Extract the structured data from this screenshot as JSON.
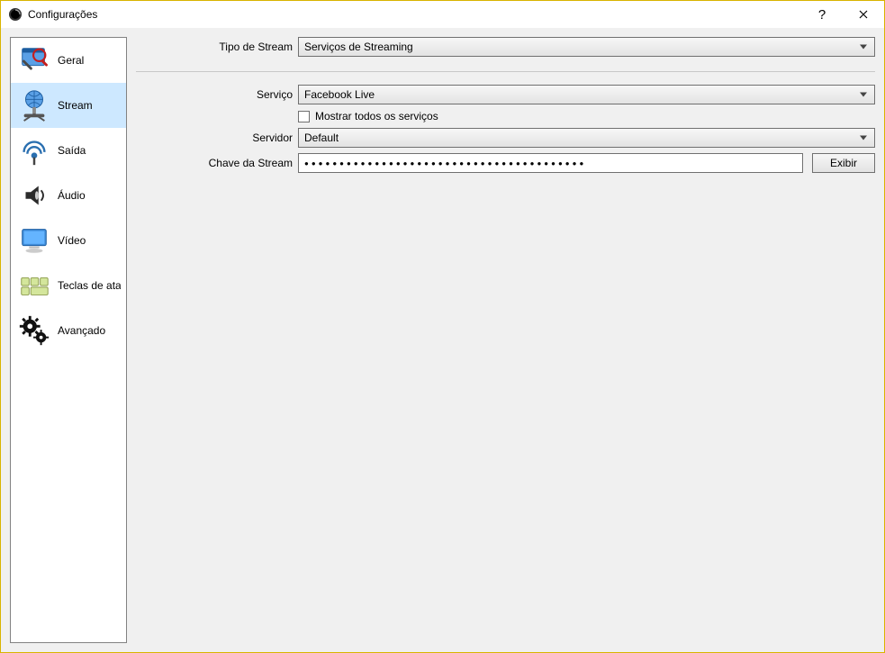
{
  "titlebar": {
    "title": "Configurações"
  },
  "sidebar": {
    "items": [
      {
        "label": "Geral"
      },
      {
        "label": "Stream"
      },
      {
        "label": "Saída"
      },
      {
        "label": "Áudio"
      },
      {
        "label": "Vídeo"
      },
      {
        "label": "Teclas de atalho"
      },
      {
        "label": "Avançado"
      }
    ]
  },
  "form": {
    "stream_type_label": "Tipo de Stream",
    "stream_type_value": "Serviços de Streaming",
    "service_label": "Serviço",
    "service_value": "Facebook Live",
    "show_all_label": "Mostrar todos os serviços",
    "server_label": "Servidor",
    "server_value": "Default",
    "stream_key_label": "Chave da Stream",
    "stream_key_value": "●●●●●●●●●●●●●●●●●●●●●●●●●●●●●●●●●●●●●●●●",
    "show_button": "Exibir"
  }
}
